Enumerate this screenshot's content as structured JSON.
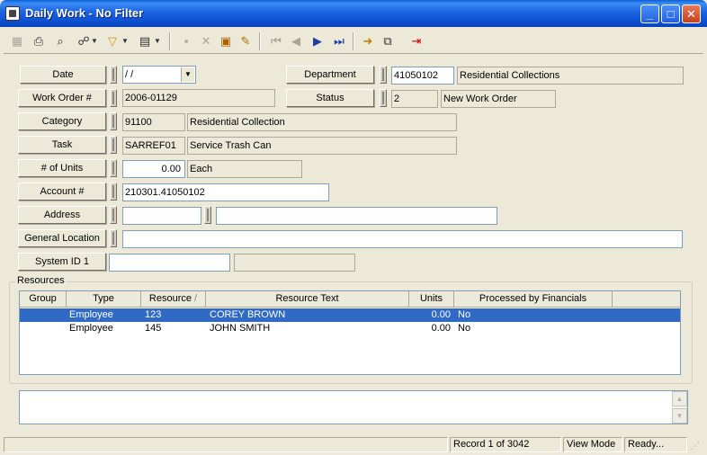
{
  "window": {
    "title": "Daily Work - No Filter",
    "minimize": "_",
    "maximize": "□",
    "close": "✕"
  },
  "toolbar": {
    "icons": [
      "grid-icon",
      "print-icon",
      "preview-icon",
      "binoculars-icon",
      "filter-icon",
      "report-icon",
      "save-icon",
      "delete-icon",
      "stack-icon",
      "edit-icon",
      "first-icon",
      "prev-icon",
      "next-icon",
      "last-icon",
      "goto-icon",
      "map-icon",
      "exit-icon"
    ]
  },
  "form": {
    "date": {
      "label": "Date",
      "value": " / /"
    },
    "department": {
      "label": "Department",
      "code": "41050102",
      "name": "Residential Collections"
    },
    "work_order": {
      "label": "Work Order #",
      "value": "2006-01129"
    },
    "status": {
      "label": "Status",
      "code": "2",
      "name": "New Work Order"
    },
    "category": {
      "label": "Category",
      "code": "91100",
      "name": "Residential Collection"
    },
    "task": {
      "label": "Task",
      "code": "SARREF01",
      "name": "Service Trash Can"
    },
    "units": {
      "label": "# of Units",
      "value": "0.00",
      "unit": "Each"
    },
    "account": {
      "label": "Account #",
      "value": "210301.41050102"
    },
    "address": {
      "label": "Address",
      "value1": "",
      "value2": ""
    },
    "general_location": {
      "label": "General Location",
      "value": ""
    },
    "system_id": {
      "label": "System ID 1",
      "value": "",
      "value2": ""
    }
  },
  "resources": {
    "label": "Resources",
    "columns": [
      "Group",
      "Type",
      "Resource",
      "Resource Text",
      "Units",
      "Processed by Financials"
    ],
    "sort_indicator": "/",
    "rows": [
      {
        "group": "",
        "type": "Employee",
        "resource": "123",
        "text": "COREY BROWN",
        "units": "0.00",
        "processed": "No"
      },
      {
        "group": "",
        "type": "Employee",
        "resource": "145",
        "text": "JOHN SMITH",
        "units": "0.00",
        "processed": "No"
      }
    ]
  },
  "notes": {
    "value": ""
  },
  "statusbar": {
    "record": "Record 1 of 3042",
    "mode": "View Mode",
    "state": "Ready..."
  }
}
